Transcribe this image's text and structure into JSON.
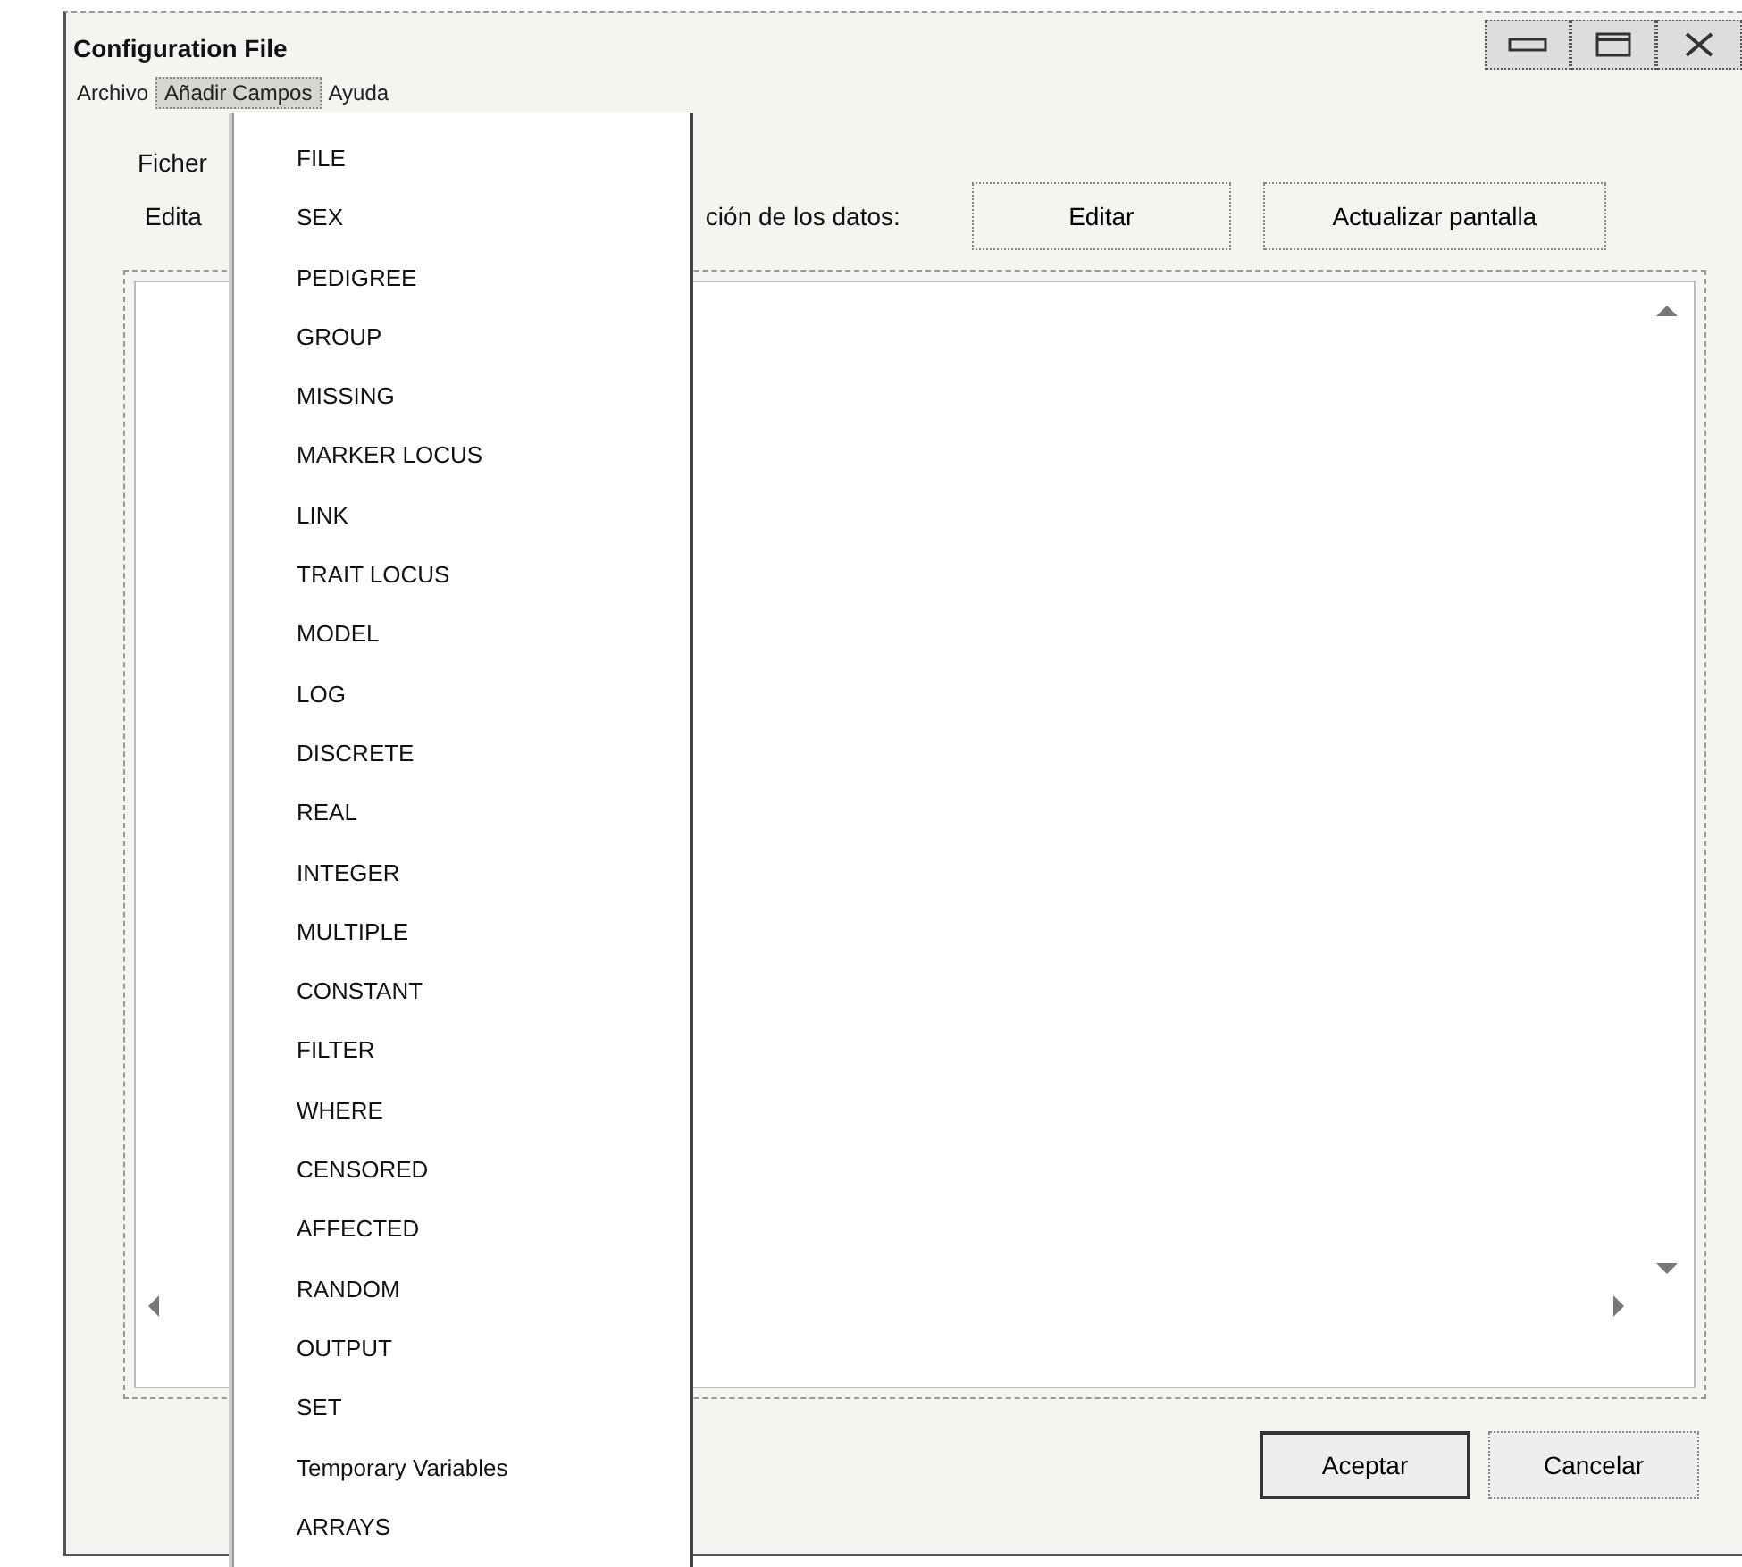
{
  "window": {
    "title": "Configuration File"
  },
  "menu_bar": [
    {
      "label": "Archivo",
      "selected": false
    },
    {
      "label": "Añadir Campos",
      "selected": true
    },
    {
      "label": "Ayuda",
      "selected": false
    }
  ],
  "dropdown": [
    "FILE",
    "SEX",
    "PEDIGREE",
    "GROUP",
    "MISSING",
    "MARKER LOCUS",
    "LINK",
    "TRAIT LOCUS",
    "MODEL",
    "LOG",
    "DISCRETE",
    "REAL",
    "INTEGER",
    "MULTIPLE",
    "CONSTANT",
    "FILTER",
    "WHERE",
    "CENSORED",
    "AFFECTED",
    "RANDOM",
    "OUTPUT",
    "SET",
    "Temporary Variables",
    "ARRAYS"
  ],
  "file_label": "Ficher",
  "edit_label": "Edita",
  "data_label": "ción de los datos:",
  "top_buttons": [
    "Editar",
    "Actualizar pantalla"
  ],
  "dialog_buttons": [
    {
      "label": "Aceptar",
      "default": true
    },
    {
      "label": "Cancelar",
      "default": false
    }
  ]
}
